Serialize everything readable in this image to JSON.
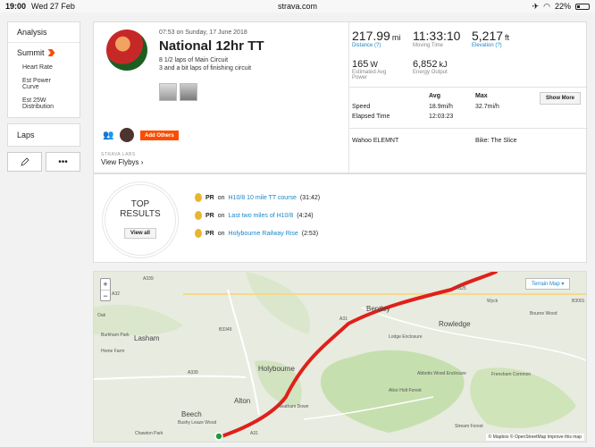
{
  "status": {
    "time": "19:00",
    "date": "Wed 27 Feb",
    "url": "strava.com",
    "battery": "22%"
  },
  "sidebar": {
    "analysis": "Analysis",
    "summit": "Summit",
    "sub_items": [
      "Heart Rate",
      "Est Power Curve",
      "Est 25W Distribution"
    ],
    "laps": "Laps",
    "edit_icon": "pencil-icon",
    "more_label": "•••"
  },
  "activity": {
    "date": "07:53 on Sunday, 17 June 2018",
    "title": "National 12hr TT",
    "desc_line1": "8 1/2 laps of Main Circuit",
    "desc_line2": "3 and a bit laps of finishing circuit",
    "add_others": "Add Others",
    "labs": "STRAVA LABS",
    "flybys": "View Flybys ›"
  },
  "stats": {
    "distance": {
      "value": "217.99",
      "unit": "mi",
      "label": "Distance (?)"
    },
    "moving_time": {
      "value": "11:33:10",
      "label": "Moving Time"
    },
    "elevation": {
      "value": "5,217",
      "unit": "ft",
      "label": "Elevation (?)"
    },
    "power": {
      "value": "165",
      "unit": "W",
      "label": "Estimated Avg Power"
    },
    "energy": {
      "value": "6,852",
      "unit": "kJ",
      "label": "Energy Output"
    },
    "table": {
      "avg_header": "Avg",
      "max_header": "Max",
      "speed_label": "Speed",
      "speed_avg": "18.9mi/h",
      "speed_max": "32.7mi/h",
      "elapsed_label": "Elapsed Time",
      "elapsed_value": "12:03:23"
    },
    "show_more": "Show More",
    "device": "Wahoo ELEMNT",
    "bike": "Bike: The Slice"
  },
  "results": {
    "title_line1": "TOP",
    "title_line2": "RESULTS",
    "view_all": "View all",
    "prs": [
      {
        "label": "PR",
        "on": "on",
        "segment": "H10/8 10 mile TT course",
        "time": "(31:42)"
      },
      {
        "label": "PR",
        "on": "on",
        "segment": "Last two miles of H10/8",
        "time": "(4:24)"
      },
      {
        "label": "PR",
        "on": "on",
        "segment": "Holybourne Railway Rise",
        "time": "(2:53)"
      }
    ]
  },
  "map": {
    "zoom_in": "+",
    "zoom_out": "−",
    "terrain": "Terrain Map ▾",
    "places": [
      "Bentley",
      "Rowledge",
      "Lasham",
      "Holybourne",
      "Alton",
      "Beech",
      "Bushy Leaze Wood",
      "Lodge Enclosure",
      "Abbotts Wood Enclosure",
      "Alice Holt Forest",
      "Frensham Common",
      "Bourne Wood",
      "Stream Forest",
      "Home Farm",
      "Burkham Park",
      "Neatham Down",
      "Wyck",
      "Oak",
      "Chawton Park"
    ],
    "roads": [
      "A339",
      "A32",
      "B3349",
      "A339",
      "A31",
      "A325",
      "B3001",
      "A31"
    ],
    "attribution": "© Mapbox © OpenStreetMap Improve this map",
    "route_color": "#e0201b"
  }
}
